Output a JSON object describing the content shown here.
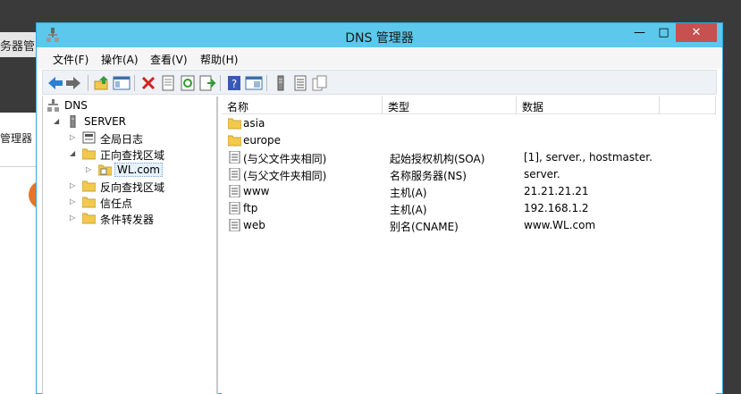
{
  "background": {
    "window_title_fragment": "务器管",
    "panel_label_fragment": "管理器"
  },
  "window": {
    "title": "DNS 管理器",
    "buttons": {
      "minimize": "—",
      "maximize": "□",
      "close": "✕"
    }
  },
  "menu": {
    "items": [
      "文件(F)",
      "操作(A)",
      "查看(V)",
      "帮助(H)"
    ]
  },
  "toolbar": {
    "buttons": [
      "back-icon",
      "forward-icon",
      "up-icon",
      "show-tree-icon",
      "delete-icon",
      "properties-icon",
      "refresh-icon",
      "export-icon",
      "help-icon",
      "view-icon",
      "server-icon",
      "list-icon",
      "copy-icon"
    ]
  },
  "tree": {
    "items": [
      {
        "label": "DNS",
        "icon": "dns-icon",
        "arrow": ""
      },
      {
        "label": "SERVER",
        "icon": "server-icon",
        "arrow": "◢"
      },
      {
        "label": "全局日志",
        "icon": "log-icon",
        "arrow": "▷"
      },
      {
        "label": "正向查找区域",
        "icon": "folder-icon",
        "arrow": "◢"
      },
      {
        "label": "WL.com",
        "icon": "zone-icon",
        "arrow": "▷"
      },
      {
        "label": "反向查找区域",
        "icon": "folder-icon",
        "arrow": "▷"
      },
      {
        "label": "信任点",
        "icon": "folder-icon",
        "arrow": "▷"
      },
      {
        "label": "条件转发器",
        "icon": "folder-icon",
        "arrow": "▷"
      }
    ]
  },
  "list": {
    "columns": [
      "名称",
      "类型",
      "数据"
    ],
    "rows": [
      {
        "name": "asia",
        "type": "",
        "data": "",
        "icon": "folder-icon"
      },
      {
        "name": "europe",
        "type": "",
        "data": "",
        "icon": "folder-icon"
      },
      {
        "name": "(与父文件夹相同)",
        "type": "起始授权机构(SOA)",
        "data": "[1], server., hostmaster.",
        "icon": "record-icon"
      },
      {
        "name": "(与父文件夹相同)",
        "type": "名称服务器(NS)",
        "data": "server.",
        "icon": "record-icon"
      },
      {
        "name": "www",
        "type": "主机(A)",
        "data": "21.21.21.21",
        "icon": "record-icon"
      },
      {
        "name": "ftp",
        "type": "主机(A)",
        "data": "192.168.1.2",
        "icon": "record-icon"
      },
      {
        "name": "web",
        "type": "别名(CNAME)",
        "data": "www.WL.com",
        "icon": "record-icon"
      }
    ]
  },
  "colors": {
    "titlebar": "#5bc8ec",
    "close_button": "#c75050",
    "folder": "#f2c94c"
  }
}
